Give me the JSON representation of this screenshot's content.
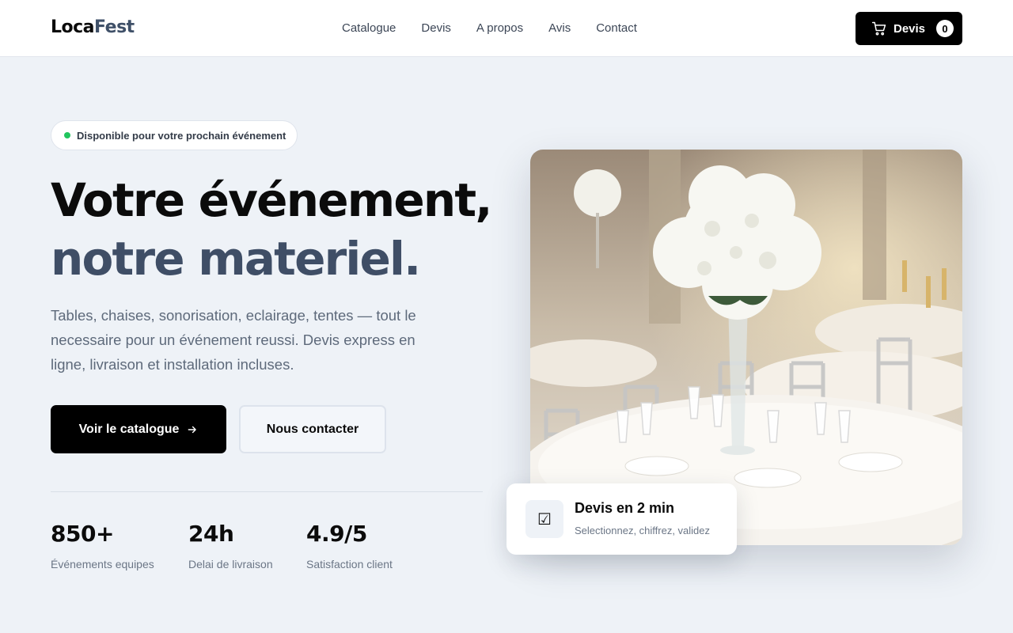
{
  "header": {
    "logo_part1": "Loca",
    "logo_part2": "Fest",
    "nav": [
      "Catalogue",
      "Devis",
      "A propos",
      "Avis",
      "Contact"
    ],
    "cart_label": "Devis",
    "cart_count": "0"
  },
  "hero": {
    "badge": "Disponible pour votre prochain événement",
    "title_line1": "Votre événement,",
    "title_line2": "notre materiel.",
    "lead": "Tables, chaises, sonorisation, eclairage, tentes — tout le necessaire pour un événement reussi. Devis express en ligne, livraison et installation incluses.",
    "primary_button": "Voir le catalogue",
    "secondary_button": "Nous contacter",
    "stats": [
      {
        "value": "850+",
        "label": "Événements equipes"
      },
      {
        "value": "24h",
        "label": "Delai de livraison"
      },
      {
        "value": "4.9/5",
        "label": "Satisfaction client"
      }
    ]
  },
  "float_card": {
    "title": "Devis en 2 min",
    "subtitle": "Selectionnez, chiffrez, validez",
    "icon": "checkbox-icon"
  },
  "colors": {
    "accent": "#3f4e66",
    "status_dot": "#22c55e",
    "primary": "#000000"
  }
}
